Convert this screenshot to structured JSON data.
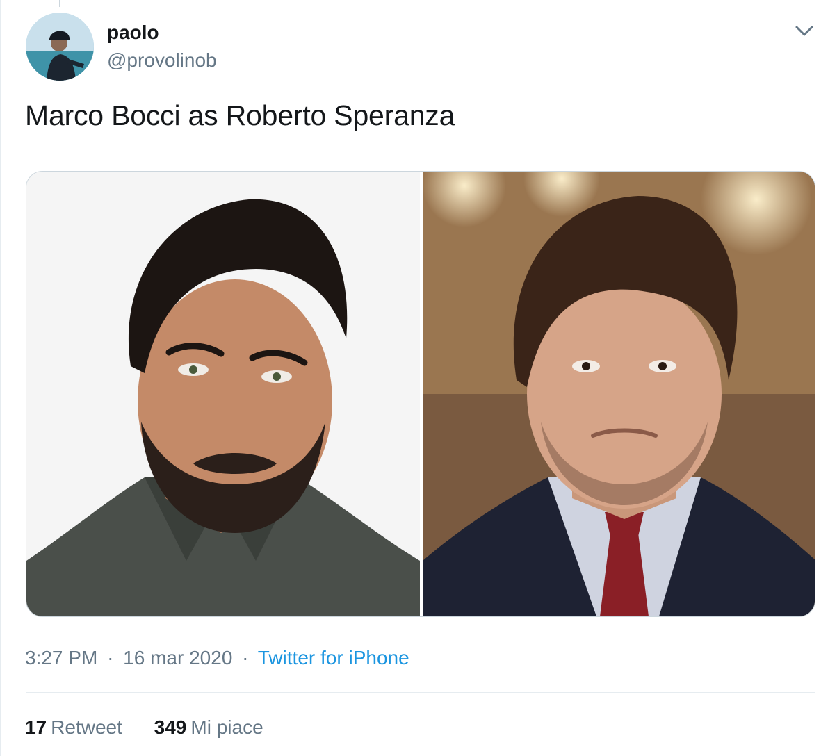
{
  "tweet": {
    "author": {
      "display_name": "paolo",
      "handle": "@provolinob"
    },
    "text": "Marco Bocci as Roberto Speranza",
    "media": [
      {
        "description_icon": "photo-portrait-bearded-man"
      },
      {
        "description_icon": "photo-portrait-man-in-suit"
      }
    ],
    "time": "3:27 PM",
    "date": "16 mar 2020",
    "separator": "·",
    "source": "Twitter for iPhone",
    "stats": {
      "retweets_count": "17",
      "retweets_label": "Retweet",
      "likes_count": "349",
      "likes_label": "Mi piace"
    }
  },
  "colors": {
    "text_primary": "#14171a",
    "text_secondary": "#657786",
    "link": "#1b95e0",
    "border": "#e6ecf0"
  },
  "icons": {
    "menu": "chevron-down-icon"
  }
}
